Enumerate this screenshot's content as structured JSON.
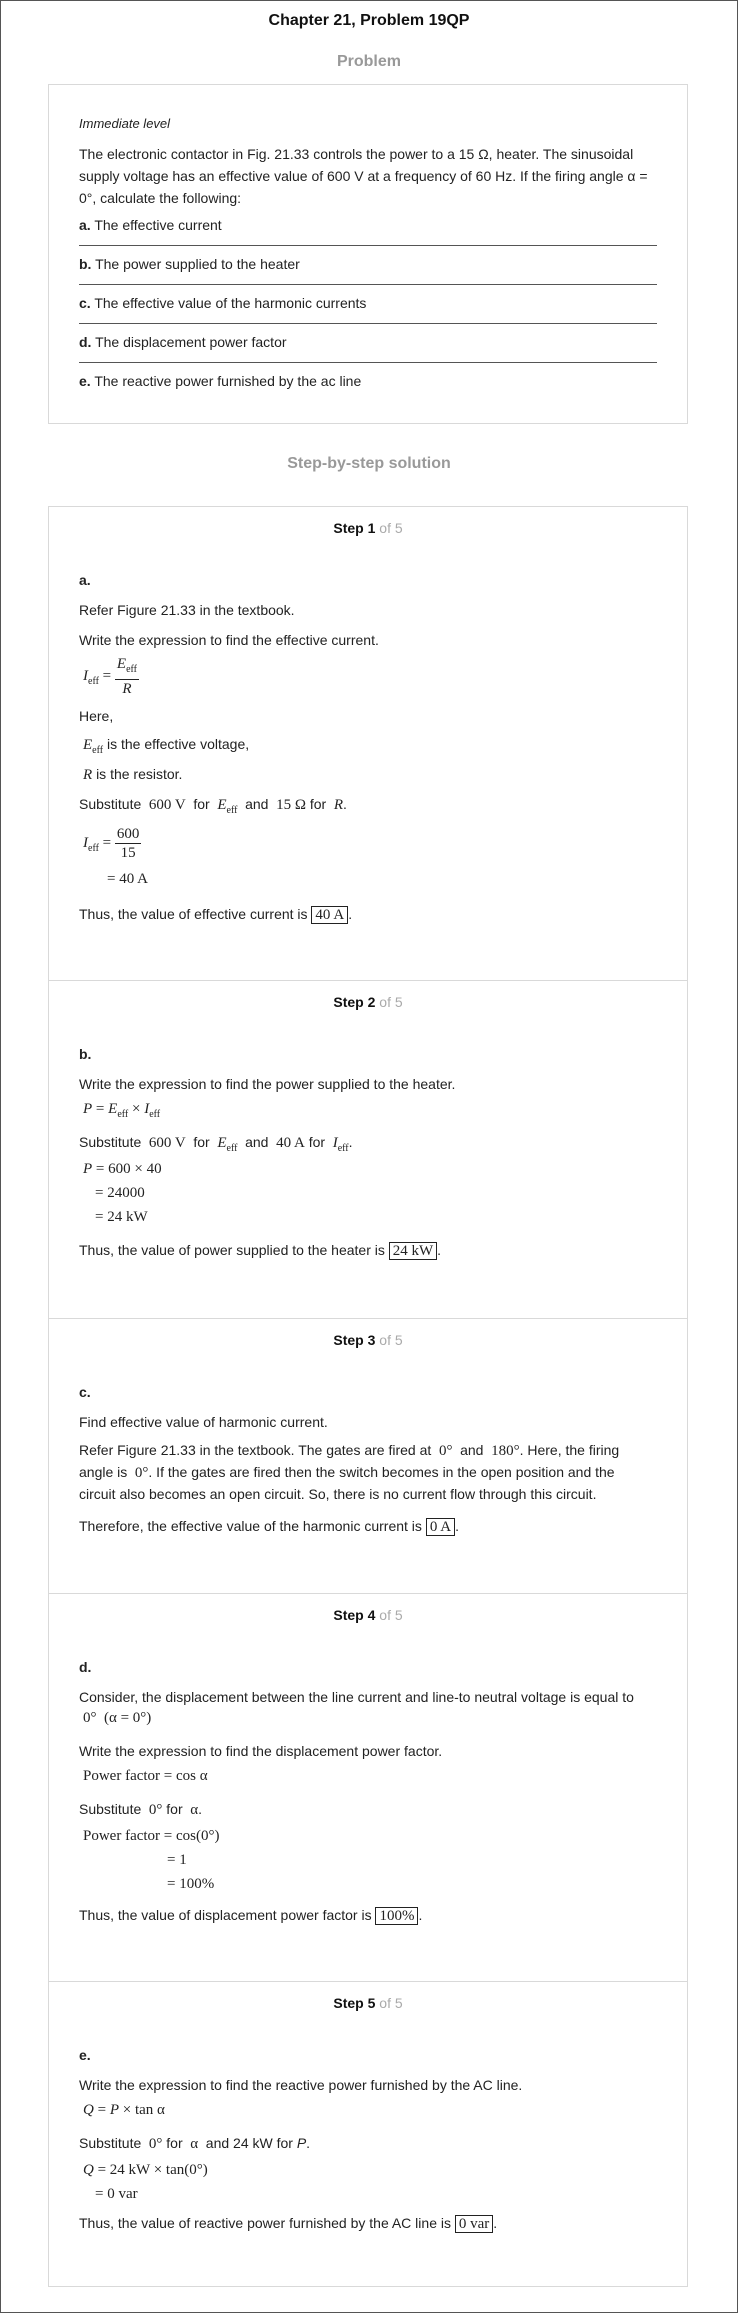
{
  "header": {
    "title": "Chapter 21, Problem 19QP",
    "problem_heading": "Problem",
    "solution_heading": "Step-by-step solution"
  },
  "problem": {
    "level": "Immediate level",
    "statement": "The electronic contactor in Fig. 21.33 controls the power to a 15 Ω, heater. The sinusoidal supply voltage has an effective value of 600 V at a frequency of 60 Hz. If the firing angle α = 0°, calculate the following:",
    "items": [
      {
        "label": "a.",
        "text": "The effective current"
      },
      {
        "label": "b.",
        "text": "The power supplied to the heater"
      },
      {
        "label": "c.",
        "text": "The effective value of the harmonic currents"
      },
      {
        "label": "d.",
        "text": "The displacement power factor"
      },
      {
        "label": "e.",
        "text": "The reactive power furnished by the ac line"
      }
    ]
  },
  "steps": [
    {
      "label": "Step",
      "num": "1",
      "of": "of 5",
      "part": "a.",
      "l1": "Refer Figure 21.33 in the textbook.",
      "l2": "Write the expression to find the effective current.",
      "here": "Here,",
      "def1": "is the effective voltage,",
      "def2": "is the resistor.",
      "sub_text": "Substitute",
      "sub_for": "for",
      "sub_and": "and",
      "result": "Thus, the value of effective current is",
      "answer": "40 A"
    },
    {
      "label": "Step",
      "num": "2",
      "of": "of 5",
      "part": "b.",
      "l1": "Write the expression to find the power supplied to the heater.",
      "sub_text": "Substitute",
      "result": "Thus, the value of power supplied to the heater is",
      "answer": "24 kW"
    },
    {
      "label": "Step",
      "num": "3",
      "of": "of 5",
      "part": "c.",
      "l1": "Find effective value of harmonic current.",
      "l2a": "Refer Figure 21.33 in the textbook. The gates are fired at",
      "l2b": "and",
      "l2c": ". Here, the firing",
      "l3a": "angle is",
      "l3b": ". If the gates are fired then the switch becomes in the open position and the",
      "l4": "circuit also becomes an open circuit. So, there is no current flow through this circuit.",
      "result": "Therefore, the effective value of the harmonic current is",
      "answer": "0 A"
    },
    {
      "label": "Step",
      "num": "4",
      "of": "of 5",
      "part": "d.",
      "l1": "Consider, the displacement between the line current and line-to neutral voltage is equal to",
      "l2": "Write the expression to find the displacement power factor.",
      "sub_text": "Substitute",
      "result": "Thus, the value of displacement power factor is",
      "answer": "100%"
    },
    {
      "label": "Step",
      "num": "5",
      "of": "of 5",
      "part": "e.",
      "l1": "Write the expression to find the reactive power furnished by the AC line.",
      "sub_text": "Substitute",
      "sub_mid": "and 24 kW for",
      "result": "Thus, the value of reactive power furnished by the AC line is",
      "answer": "0 var"
    }
  ]
}
